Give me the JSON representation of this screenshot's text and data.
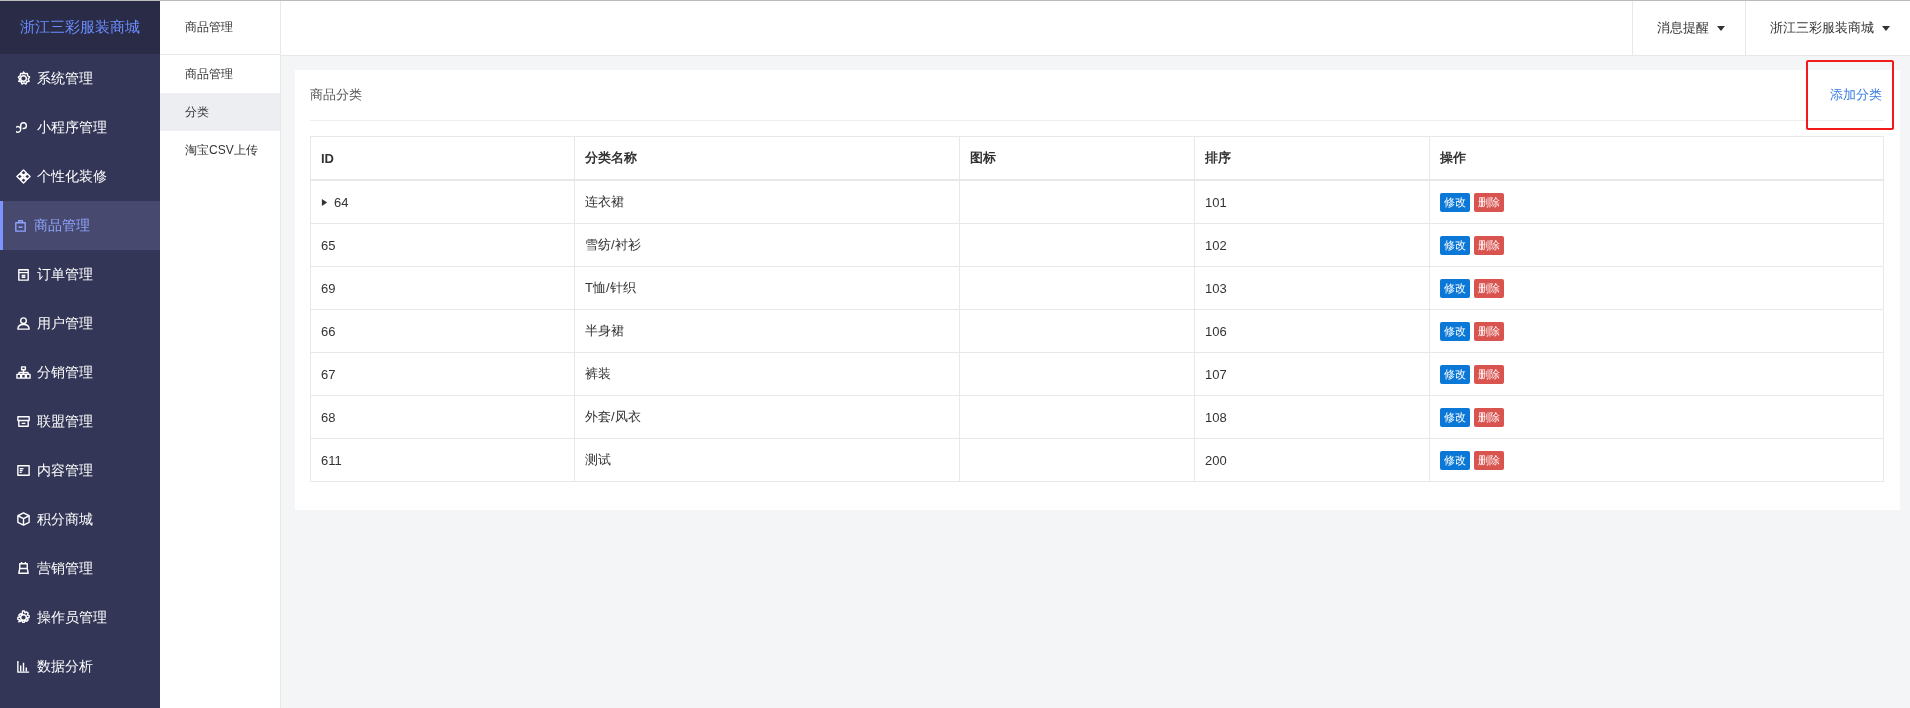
{
  "brand": "浙江三彩服装商城",
  "sidebar": {
    "items": [
      {
        "label": "系统管理",
        "selected": false
      },
      {
        "label": "小程序管理",
        "selected": false
      },
      {
        "label": "个性化装修",
        "selected": false
      },
      {
        "label": "商品管理",
        "selected": true
      },
      {
        "label": "订单管理",
        "selected": false
      },
      {
        "label": "用户管理",
        "selected": false
      },
      {
        "label": "分销管理",
        "selected": false
      },
      {
        "label": "联盟管理",
        "selected": false
      },
      {
        "label": "内容管理",
        "selected": false
      },
      {
        "label": "积分商城",
        "selected": false
      },
      {
        "label": "营销管理",
        "selected": false
      },
      {
        "label": "操作员管理",
        "selected": false
      },
      {
        "label": "数据分析",
        "selected": false
      }
    ]
  },
  "subnav": {
    "title": "商品管理",
    "items": [
      {
        "label": "商品管理",
        "selected": false
      },
      {
        "label": "分类",
        "selected": true
      },
      {
        "label": "淘宝CSV上传",
        "selected": false
      }
    ]
  },
  "topbar": {
    "menus": [
      "消息提醒",
      "浙江三彩服装商城"
    ]
  },
  "panel": {
    "title": "商品分类",
    "add_link": {
      "label": "添加分类",
      "highlighted": true
    }
  },
  "table": {
    "columns": [
      "ID",
      "分类名称",
      "图标",
      "排序",
      "操作"
    ],
    "rows": [
      {
        "id": "64",
        "expandable": true,
        "name": "连衣裙",
        "sort": "101",
        "actions": [
          "修改",
          "删除"
        ]
      },
      {
        "id": "65",
        "expandable": false,
        "name": "雪纺/衬衫",
        "sort": "102",
        "actions": [
          "修改",
          "删除"
        ]
      },
      {
        "id": "69",
        "expandable": false,
        "name": "T恤/针织",
        "sort": "103",
        "actions": [
          "修改",
          "删除"
        ]
      },
      {
        "id": "66",
        "expandable": false,
        "name": "半身裙",
        "sort": "106",
        "actions": [
          "修改",
          "删除"
        ]
      },
      {
        "id": "67",
        "expandable": false,
        "name": "裤装",
        "sort": "107",
        "actions": [
          "修改",
          "删除"
        ]
      },
      {
        "id": "68",
        "expandable": false,
        "name": "外套/风衣",
        "sort": "108",
        "actions": [
          "修改",
          "删除"
        ]
      },
      {
        "id": "611",
        "expandable": false,
        "name": "测试",
        "sort": "200",
        "actions": [
          "修改",
          "删除"
        ]
      }
    ]
  }
}
